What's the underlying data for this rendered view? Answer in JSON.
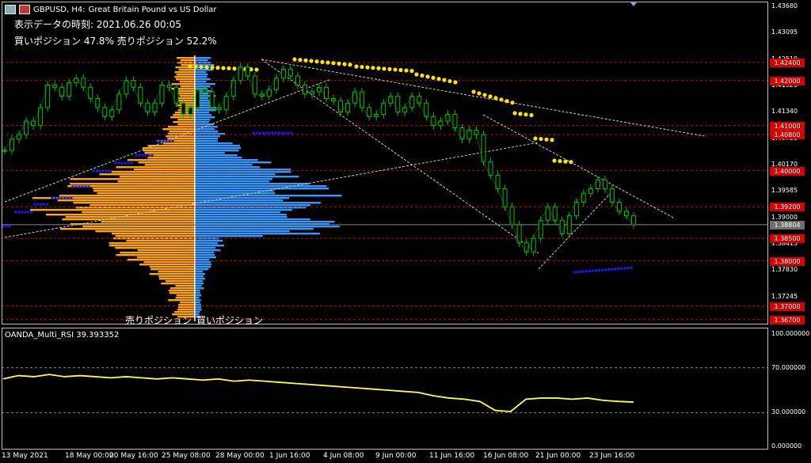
{
  "title": {
    "symbol_timeframe": "GBPUSD, H4:",
    "description": "Great Britain Pound vs US Dollar"
  },
  "info": {
    "display_time": "表示データの時刻: 2021.06.26 00:05",
    "position_ratio": "買いポジション 47.8% 売りポジション 52.2%"
  },
  "labels": {
    "sell_position": "売りポジション",
    "buy_position": "買いポジション"
  },
  "indicator": {
    "name": "OANDA_Multi_RSI 39.393352"
  },
  "price_axis": {
    "labels": [
      "1.43680",
      "1.43095",
      "1.42510",
      "1.41925",
      "1.41340",
      "1.40755",
      "1.40170",
      "1.39585",
      "1.39000",
      "1.38415",
      "1.37830",
      "1.37245",
      "1.36660"
    ],
    "marked_levels": [
      {
        "text": "1.42400",
        "color": "#d40000"
      },
      {
        "text": "1.42000",
        "color": "#d40000"
      },
      {
        "text": "1.41000",
        "color": "#d40000"
      },
      {
        "text": "1.40800",
        "color": "#d40000"
      },
      {
        "text": "1.40000",
        "color": "#d40000"
      },
      {
        "text": "1.39200",
        "color": "#d40000"
      },
      {
        "text": "1.38804",
        "color": "#6e6e6e"
      },
      {
        "text": "1.38500",
        "color": "#d40000"
      },
      {
        "text": "1.38000",
        "color": "#d40000"
      },
      {
        "text": "1.37000",
        "color": "#d40000"
      },
      {
        "text": "1.36700",
        "color": "#d40000"
      }
    ]
  },
  "rsi_axis": {
    "labels": [
      "100.000000",
      "70.000000",
      "30.000000",
      "0.000000"
    ]
  },
  "time_axis": {
    "labels": [
      "13 May 2021",
      "18 May 00:00",
      "20 May 16:00",
      "25 May 08:00",
      "28 May 00:00",
      "1 Jun 16:00",
      "4 Jun 08:00",
      "9 Jun 00:00",
      "11 Jun 16:00",
      "16 Jun 08:00",
      "21 Jun 00:00",
      "23 Jun 16:00"
    ]
  },
  "chart_data": {
    "type": "candlestick",
    "symbol": "GBPUSD",
    "timeframe": "H4",
    "current_price": 1.38804,
    "ylim": [
      1.3666,
      1.4368
    ],
    "close_path": [
      1.4045,
      1.407,
      1.408,
      1.411,
      1.41,
      1.414,
      1.419,
      1.4185,
      1.4165,
      1.4195,
      1.4205,
      1.4185,
      1.416,
      1.414,
      1.412,
      1.4135,
      1.417,
      1.42,
      1.4185,
      1.415,
      1.413,
      1.415,
      1.419,
      1.4185,
      1.415,
      1.4125,
      1.414,
      1.418,
      1.4175,
      1.414,
      1.4135,
      1.4165,
      1.42,
      1.423,
      1.421,
      1.417,
      1.4165,
      1.418,
      1.4205,
      1.4225,
      1.421,
      1.419,
      1.417,
      1.4175,
      1.4185,
      1.416,
      1.4155,
      1.413,
      1.415,
      1.4175,
      1.414,
      1.412,
      1.4125,
      1.415,
      1.4165,
      1.413,
      1.414,
      1.4165,
      1.415,
      1.412,
      1.41,
      1.411,
      1.4125,
      1.4095,
      1.407,
      1.409,
      1.408,
      1.402,
      1.399,
      1.396,
      1.392,
      1.388,
      1.384,
      1.382,
      1.385,
      1.389,
      1.392,
      1.389,
      1.386,
      1.39,
      1.393,
      1.395,
      1.396,
      1.398,
      1.396,
      1.393,
      1.391,
      1.39,
      1.388
    ],
    "rsi": {
      "name": "OANDA_Multi_RSI",
      "last": 39.393352,
      "ylim": [
        0,
        100
      ],
      "levels": [
        70,
        30
      ],
      "path": [
        60,
        63,
        62,
        64,
        62,
        63,
        62,
        61,
        62,
        61,
        60,
        61,
        60,
        59,
        60,
        58,
        59,
        58,
        57,
        56,
        55,
        54,
        53,
        52,
        51,
        50,
        49,
        48,
        45,
        43,
        42,
        40,
        32,
        31,
        42,
        43,
        43,
        42,
        43,
        41,
        40,
        39.39
      ]
    },
    "x_ticks": [
      "13 May 2021",
      "18 May 00:00",
      "20 May 16:00",
      "25 May 08:00",
      "28 May 00:00",
      "1 Jun 16:00",
      "4 Jun 08:00",
      "9 Jun 00:00",
      "11 Jun 16:00",
      "16 Jun 08:00",
      "21 Jun 00:00",
      "23 Jun 16:00"
    ],
    "order_book": {
      "buy_percent": 47.8,
      "sell_percent": 52.2,
      "snapshot_time": "2021.06.26 00:05"
    }
  },
  "colors": {
    "background": "#000000",
    "candle": "#00c000",
    "sell_histogram": "#ffa500",
    "buy_histogram": "#3399ff",
    "level_line": "#d40000",
    "yellow_dots": "#ffe400",
    "blue_dots": "#1a1aff",
    "rsi_line": "#ffff40"
  }
}
